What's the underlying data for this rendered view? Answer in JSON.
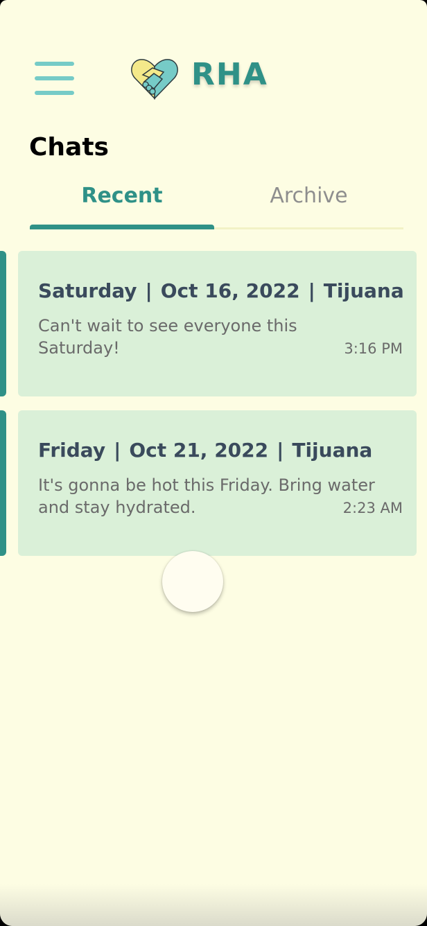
{
  "header": {
    "logo_text": "RHA",
    "menu_icon": "hamburger-menu-icon",
    "logo_icon": "handshake-heart-icon",
    "colors": {
      "brand_teal": "#2f9187",
      "menu_teal": "#76cbc7",
      "logo_yellow": "#f4e98a",
      "background": "#fdfde3"
    }
  },
  "page": {
    "title": "Chats"
  },
  "tabs": [
    {
      "label": "Recent",
      "active": true
    },
    {
      "label": "Archive",
      "active": false
    }
  ],
  "chats": [
    {
      "day": "Saturday",
      "date": "Oct 16, 2022",
      "location": "Tijuana",
      "separator": "|",
      "message": "Can't wait to see everyone this Saturday!",
      "time": "3:16 PM"
    },
    {
      "day": "Friday",
      "date": "Oct 21, 2022",
      "location": "Tijuana",
      "separator": "|",
      "message": "It's gonna be hot this Friday. Bring water and stay hydrated.",
      "time": "2:23 AM"
    }
  ],
  "card_colors": {
    "card_bg": "#daf0d8",
    "header_text": "#3a4a5c",
    "body_text": "#6a6a6a"
  }
}
